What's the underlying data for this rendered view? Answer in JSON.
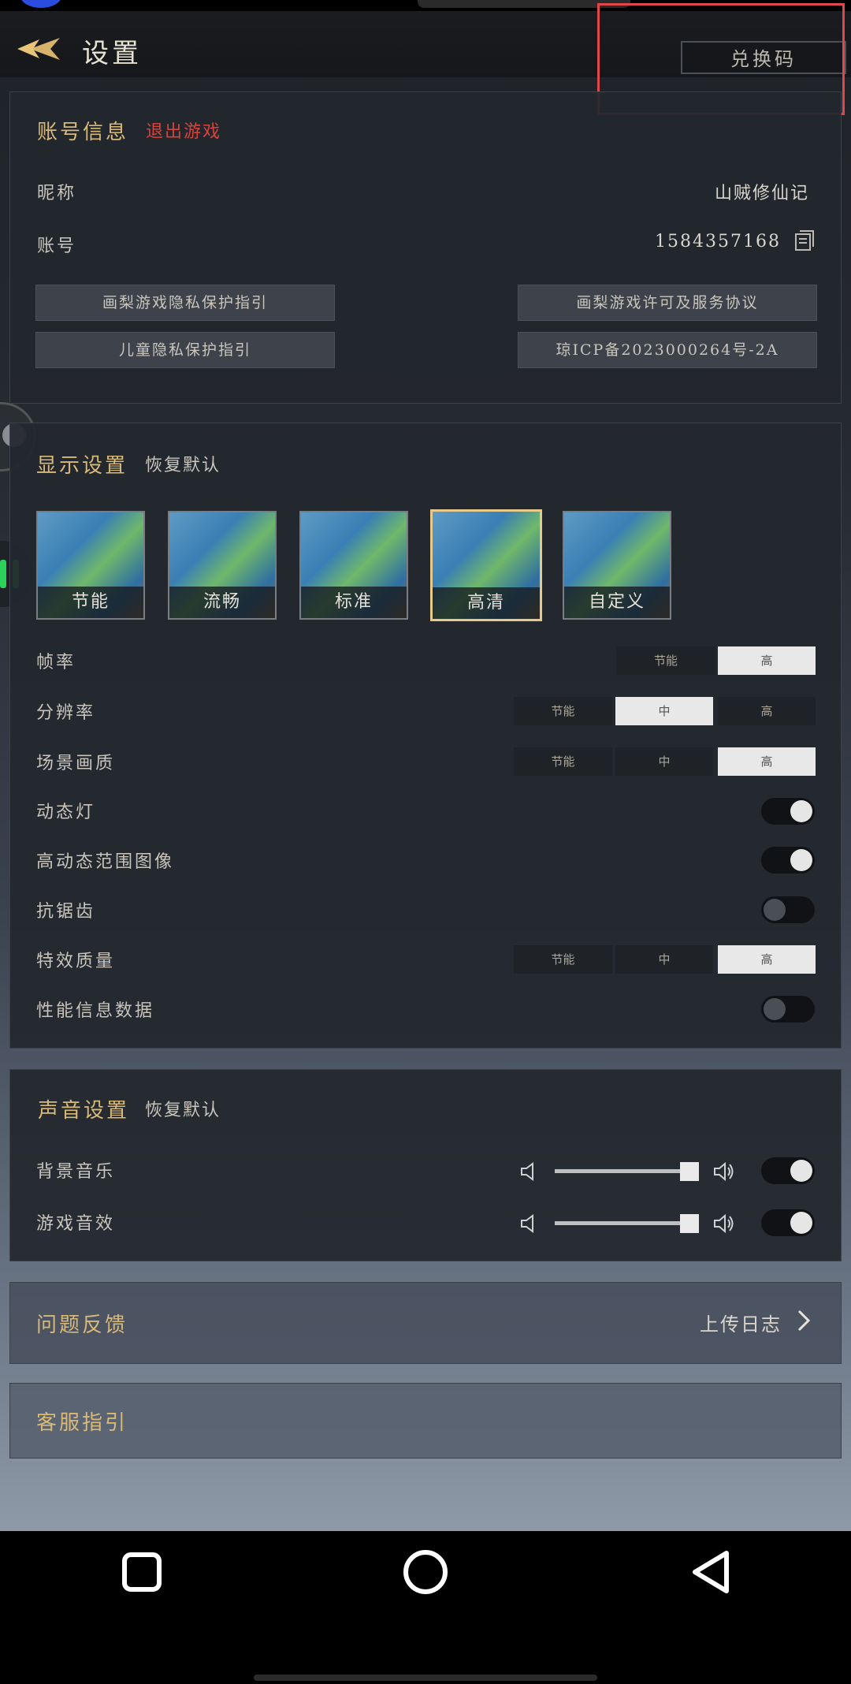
{
  "header": {
    "title": "设置",
    "redeem_label": "兑换码"
  },
  "account": {
    "title": "账号信息",
    "logout_label": "退出游戏",
    "nickname_label": "昵称",
    "nickname_value": "山贼修仙记",
    "account_label": "账号",
    "account_value": "1584357168",
    "links": [
      "画梨游戏隐私保护指引",
      "画梨游戏许可及服务协议",
      "儿童隐私保护指引",
      "琼ICP备2023000264号-2A"
    ]
  },
  "display": {
    "title": "显示设置",
    "reset_label": "恢复默认",
    "presets": [
      "节能",
      "流畅",
      "标准",
      "高清",
      "自定义"
    ],
    "active_preset": "高清",
    "framerate": {
      "label": "帧率",
      "options": [
        "节能",
        "高"
      ],
      "selected": "高"
    },
    "resolution": {
      "label": "分辨率",
      "options": [
        "节能",
        "中",
        "高"
      ],
      "selected": "中"
    },
    "scene_quality": {
      "label": "场景画质",
      "options": [
        "节能",
        "中",
        "高"
      ],
      "selected": "高"
    },
    "dynamic_light": {
      "label": "动态灯",
      "on": true
    },
    "hdr": {
      "label": "高动态范围图像",
      "on": true
    },
    "antialias": {
      "label": "抗锯齿",
      "on": false
    },
    "effects_quality": {
      "label": "特效质量",
      "options": [
        "节能",
        "中",
        "高"
      ],
      "selected": "高"
    },
    "perf_info": {
      "label": "性能信息数据",
      "on": false
    }
  },
  "sound": {
    "title": "声音设置",
    "reset_label": "恢复默认",
    "bgm": {
      "label": "背景音乐",
      "level": 1.0,
      "on": true
    },
    "sfx": {
      "label": "游戏音效",
      "level": 1.0,
      "on": true
    }
  },
  "feedback": {
    "title": "问题反馈",
    "upload_label": "上传日志"
  },
  "support": {
    "title": "客服指引"
  },
  "colors": {
    "accent_gold": "#d8b978",
    "logout_red": "#d8443c",
    "toggle_on_knob": "#e6e6e6"
  },
  "icons": [
    "back-arrow-icon",
    "copy-icon",
    "chevron-right-icon",
    "volume-mute-icon",
    "volume-icon",
    "square-recents-icon",
    "circle-home-icon",
    "triangle-back-icon"
  ]
}
